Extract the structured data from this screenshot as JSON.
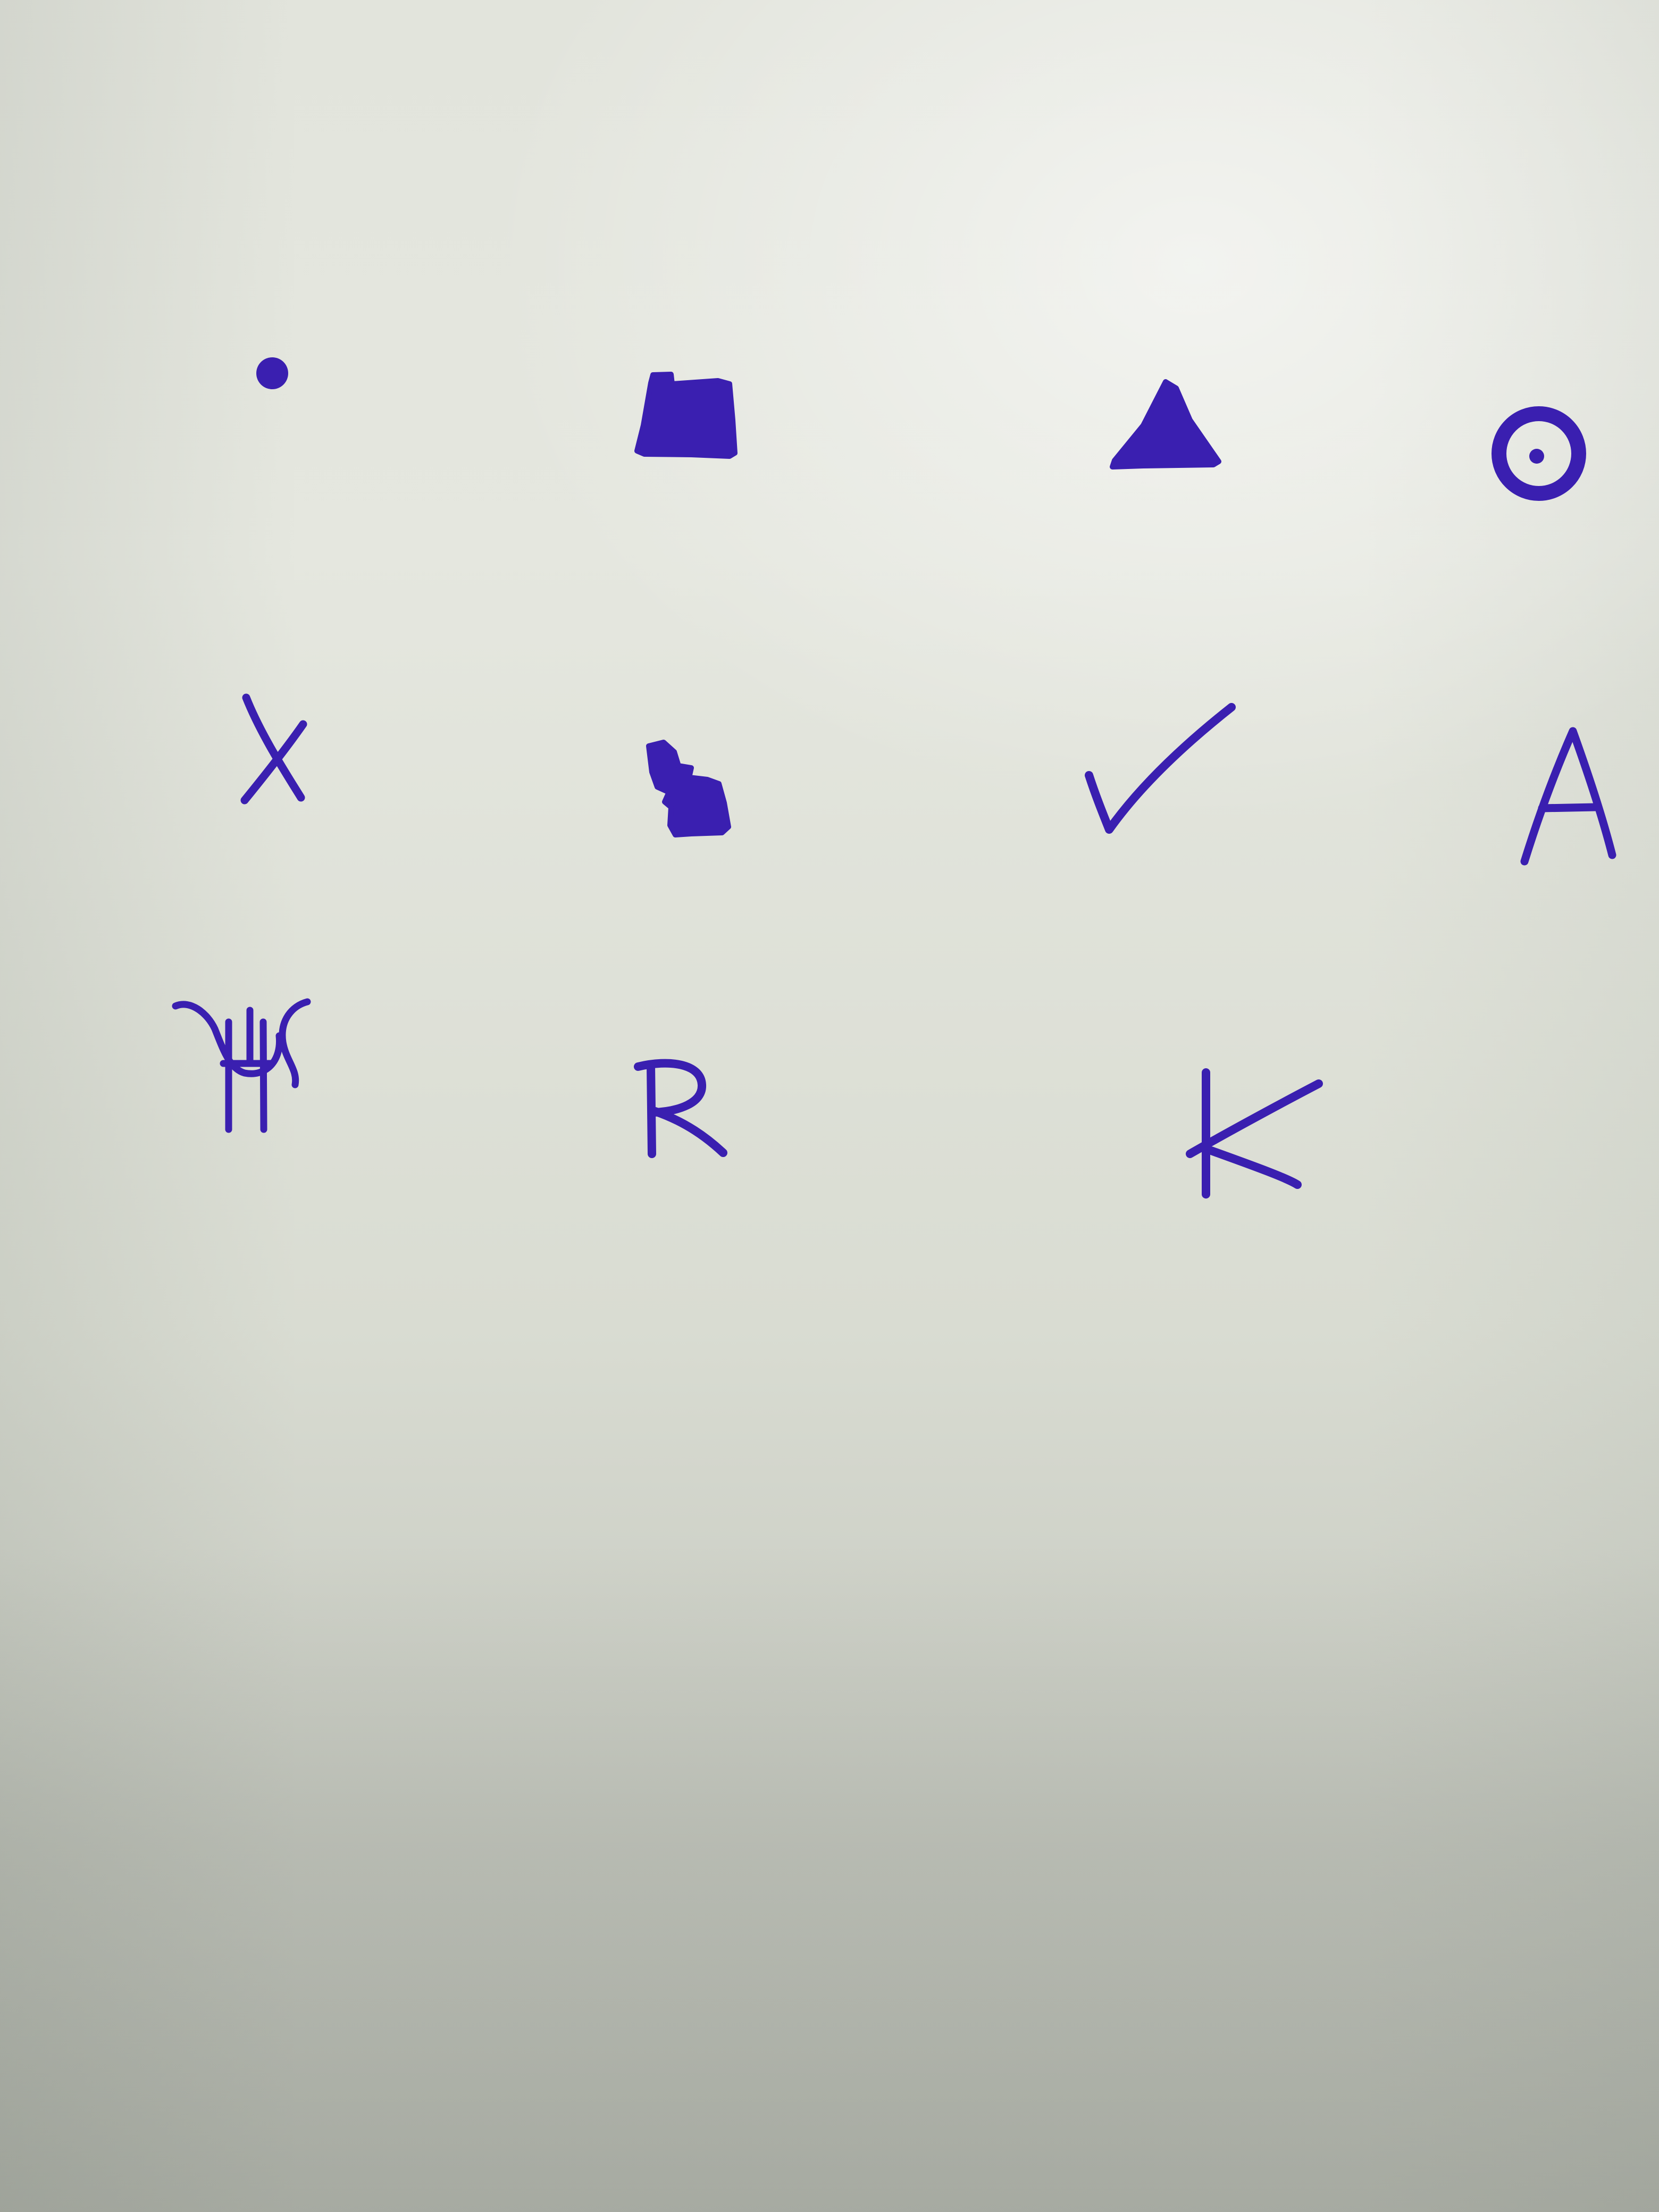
{
  "paper": {
    "color": "#e2e4dc"
  },
  "ink": {
    "color": "#3a1fb0"
  },
  "symbols": [
    {
      "name": "dot",
      "icon": "dot-icon",
      "row": 1,
      "col": 1
    },
    {
      "name": "filled-square",
      "icon": "filled-square-icon",
      "row": 1,
      "col": 2
    },
    {
      "name": "filled-triangle",
      "icon": "filled-triangle-icon",
      "row": 1,
      "col": 3
    },
    {
      "name": "circled-dot",
      "icon": "circled-dot-icon",
      "row": 1,
      "col": 4
    },
    {
      "name": "letter-x",
      "icon": "x-icon",
      "row": 2,
      "col": 1
    },
    {
      "name": "zigzag-blocks",
      "icon": "zigzag-blocks-icon",
      "row": 2,
      "col": 2
    },
    {
      "name": "checkmark",
      "icon": "checkmark-icon",
      "row": 2,
      "col": 3
    },
    {
      "name": "letter-a",
      "icon": "letter-a-icon",
      "row": 2,
      "col": 4
    },
    {
      "name": "psi-like-glyph",
      "icon": "psi-glyph-icon",
      "row": 3,
      "col": 1
    },
    {
      "name": "letter-r",
      "icon": "letter-r-icon",
      "row": 3,
      "col": 2
    },
    {
      "name": "letter-k",
      "icon": "letter-k-icon",
      "row": 3,
      "col": 3
    }
  ]
}
